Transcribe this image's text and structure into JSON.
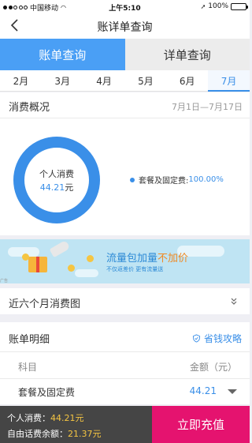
{
  "status_bar": {
    "carrier": "中国移动",
    "time": "上午5:10",
    "battery": "100%"
  },
  "nav": {
    "title": "账详单查询"
  },
  "query_tabs": [
    {
      "label": "账单查询",
      "active": true
    },
    {
      "label": "详单查询",
      "active": false
    }
  ],
  "months": [
    "2月",
    "3月",
    "4月",
    "5月",
    "6月",
    "7月"
  ],
  "overview": {
    "title": "消费概况",
    "date_range": "7月1日—7月17日",
    "center_label": "个人消费",
    "amount": "44.21",
    "unit": "元",
    "legend_label": "套餐及固定费:",
    "legend_value": "100.00%",
    "accent": "#3a8fe8",
    "share": 1.0
  },
  "banner": {
    "headline_main": "流量包加量",
    "headline_highlight": "不加价",
    "subtext": "不仅返差价 更有流量送",
    "ad_tag": "广告"
  },
  "six_months": {
    "title": "近六个月消费图"
  },
  "bill_detail": {
    "title": "账单明细",
    "save_tip": "省钱攻略",
    "col_item": "科目",
    "col_amount": "金额（元）",
    "rows": [
      {
        "item": "套餐及固定费",
        "amount": "44.21"
      }
    ]
  },
  "bottom_bar": {
    "personal_label": "个人消费：",
    "personal_value": "44.21元",
    "balance_label": "自由话费余额：",
    "balance_value": "21.37元",
    "recharge": "立即充值",
    "recharge_color": "#e5136f"
  }
}
